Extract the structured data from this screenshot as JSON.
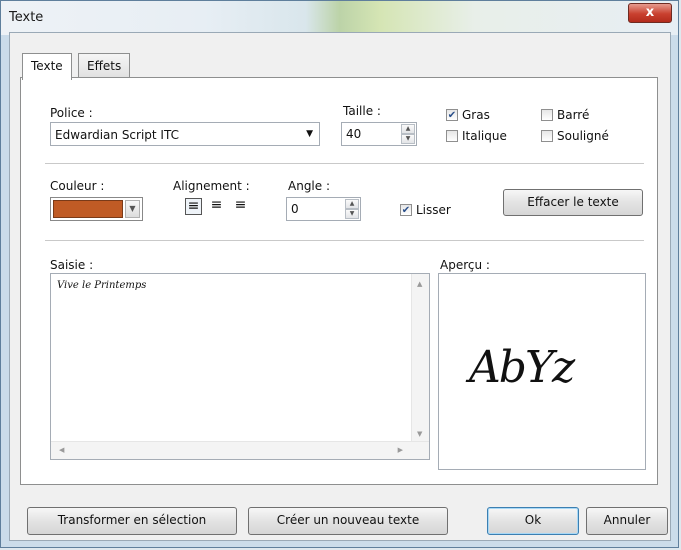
{
  "window": {
    "title": "Texte",
    "close_label": "x"
  },
  "tabs": [
    {
      "label": "Texte",
      "active": true
    },
    {
      "label": "Effets",
      "active": false
    }
  ],
  "font": {
    "label": "Police :",
    "value": "Edwardian Script ITC"
  },
  "size": {
    "label": "Taille :",
    "value": "40"
  },
  "style": {
    "gras": {
      "label": "Gras",
      "checked": true
    },
    "italique": {
      "label": "Italique",
      "checked": false
    },
    "barre": {
      "label": "Barré",
      "checked": false
    },
    "souligne": {
      "label": "Souligné",
      "checked": false
    }
  },
  "color": {
    "label": "Couleur :",
    "value": "#c05b25"
  },
  "alignment": {
    "label": "Alignement :",
    "options": [
      "left",
      "center",
      "right"
    ],
    "selected": "left"
  },
  "angle": {
    "label": "Angle :",
    "value": "0"
  },
  "smooth": {
    "label": "Lisser",
    "checked": true
  },
  "clear_button": "Effacer le texte",
  "input": {
    "label": "Saisie :",
    "text": "Vive le Printemps"
  },
  "preview": {
    "label": "Aperçu :",
    "sample": "AbYz"
  },
  "buttons": {
    "to_selection": "Transformer en sélection",
    "new_text": "Créer un nouveau texte",
    "ok": "Ok",
    "cancel": "Annuler"
  }
}
